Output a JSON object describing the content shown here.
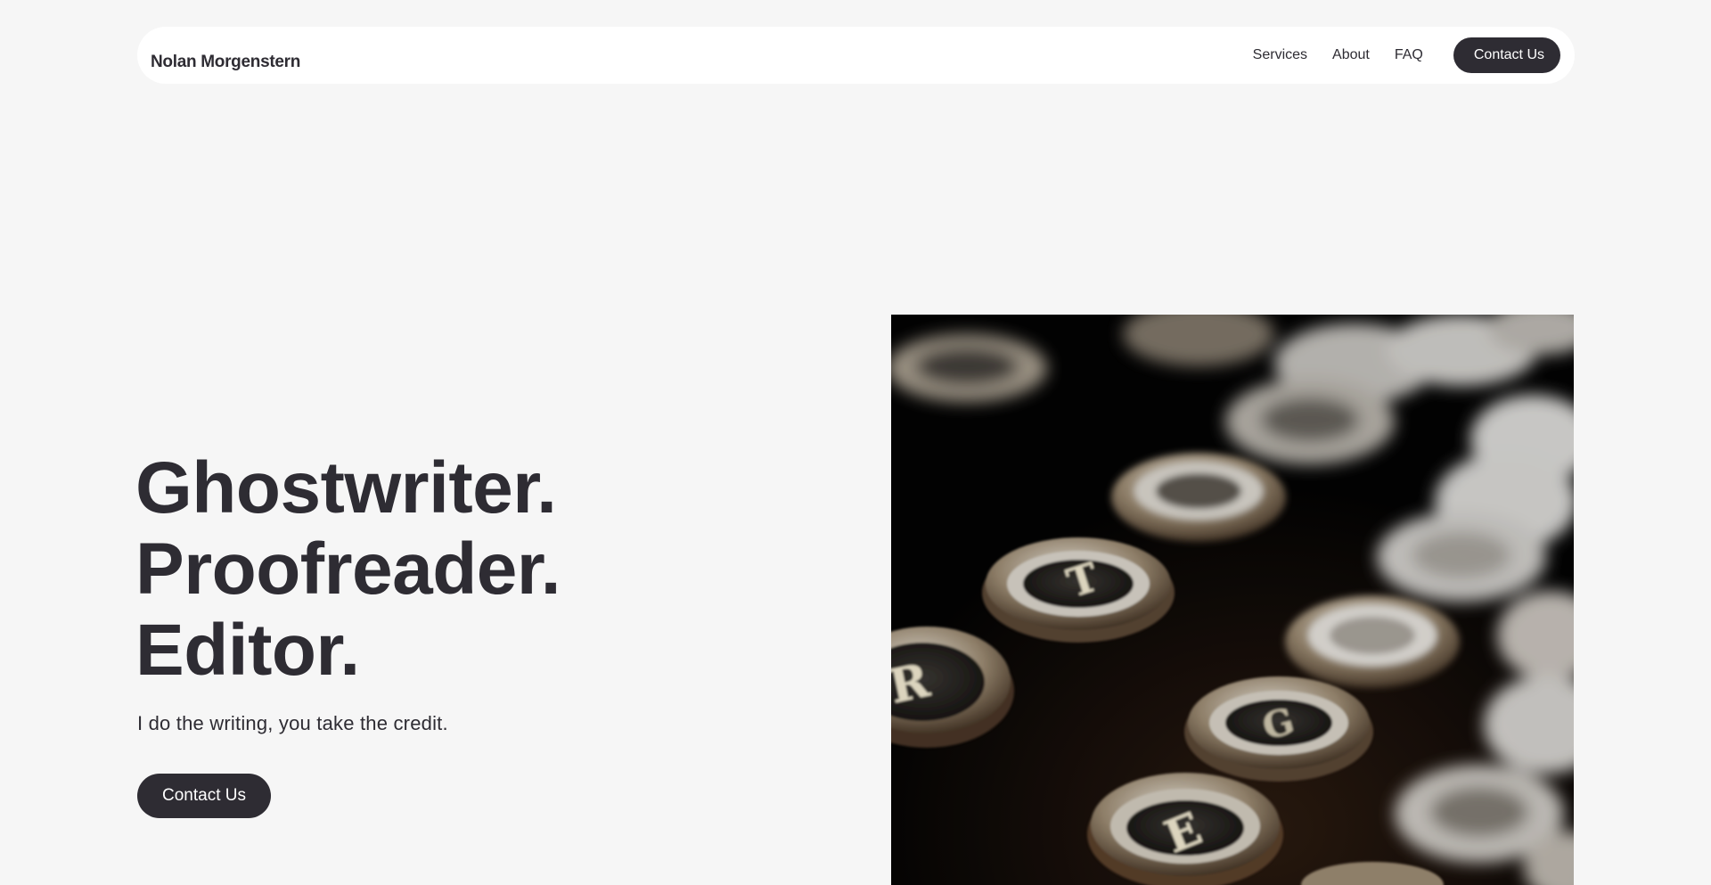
{
  "header": {
    "brand": "Nolan Morgenstern",
    "nav": [
      {
        "label": "Services"
      },
      {
        "label": "About"
      },
      {
        "label": "FAQ"
      }
    ],
    "cta_label": "Contact Us"
  },
  "hero": {
    "headline": [
      "Ghostwriter.",
      "Proofreader.",
      "Editor."
    ],
    "tagline": "I do the writing, you take the credit.",
    "cta_label": "Contact Us",
    "image": {
      "subject": "typewriter-keys-photo",
      "visible_key_letters": [
        "R",
        "T",
        "G",
        "E"
      ]
    }
  },
  "colors": {
    "background": "#f6f6f6",
    "header_bg": "#ffffff",
    "text": "#2e2c33",
    "button_bg": "#2e2c33",
    "button_text": "#ffffff"
  }
}
